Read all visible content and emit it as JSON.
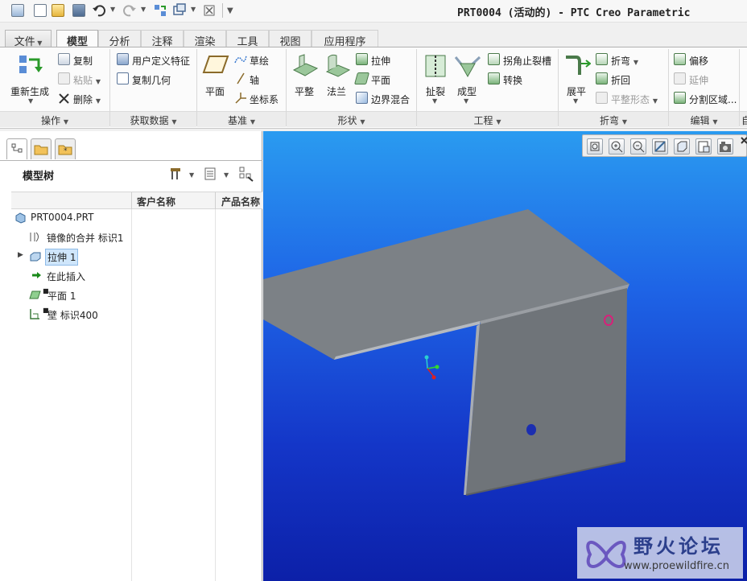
{
  "window": {
    "title": "PRT0004 (活动的) - PTC Creo Parametric"
  },
  "quick_access": {
    "icons": [
      "window-icon",
      "new-icon",
      "open-icon",
      "save-icon",
      "undo-icon",
      "redo-icon",
      "regenerate-icon",
      "switch-window-icon",
      "close-window-icon",
      "customize-icon"
    ]
  },
  "tabs": [
    {
      "label": "文件"
    },
    {
      "label": "模型"
    },
    {
      "label": "分析"
    },
    {
      "label": "注释"
    },
    {
      "label": "渲染"
    },
    {
      "label": "工具"
    },
    {
      "label": "视图"
    },
    {
      "label": "应用程序"
    }
  ],
  "ribbon": {
    "operations": {
      "footer": "操作",
      "regenerate": "重新生成",
      "copy": "复制",
      "paste": "粘贴",
      "delete": "删除"
    },
    "get_data": {
      "footer": "获取数据",
      "udf": "用户定义特征",
      "copy_geom": "复制几何"
    },
    "datum": {
      "footer": "基准",
      "plane": "平面",
      "sketch": "草绘",
      "axis": "轴",
      "csys": "坐标系"
    },
    "shapes": {
      "footer": "形状",
      "flat": "平整",
      "flange": "法兰",
      "extrude": "拉伸",
      "plane": "平面",
      "blend": "边界混合"
    },
    "engineering": {
      "footer": "工程",
      "rip": "扯裂",
      "form": "成型",
      "corner_relief": "拐角止裂槽",
      "convert": "转换"
    },
    "bend": {
      "footer": "折弯",
      "unbend": "展平",
      "bend": "折弯",
      "bend_back": "折回",
      "flat_state": "平整形态"
    },
    "editing": {
      "footer": "编辑",
      "offset": "偏移",
      "extend": "延伸",
      "split": "分割区域..."
    },
    "overflow_label": "自"
  },
  "model_tree": {
    "title": "模型树",
    "columns": [
      "客户名称",
      "产品名称"
    ],
    "items": [
      {
        "label": "PRT0004.PRT",
        "icon": "part-icon"
      },
      {
        "label": "镜像的合并 标识1",
        "icon": "mirror-merge-icon"
      },
      {
        "label": "拉伸 1",
        "icon": "extrude-feature-icon",
        "selected": true
      },
      {
        "label": "在此插入",
        "icon": "insert-here-arrow-icon"
      },
      {
        "label": "平面 1",
        "icon": "flat-wall-icon"
      },
      {
        "label": "壁 标识400",
        "icon": "wall-icon"
      }
    ]
  },
  "viewport": {
    "toolbar_icons": [
      "refit-icon",
      "zoom-in-icon",
      "zoom-out-icon",
      "repaint-icon",
      "display-style-icon",
      "saved-views-icon",
      "view-manager-icon"
    ]
  },
  "watermark": {
    "title": "野火论坛",
    "url": "www.proewildfire.cn"
  }
}
